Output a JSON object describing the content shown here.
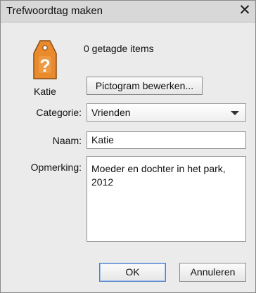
{
  "dialog": {
    "title": "Trefwoordtag maken",
    "close_glyph": "✕",
    "icon": "tag-question-icon",
    "accent_color": "#e98a2c",
    "icon_caption": "Katie",
    "tagged_count_text": "0 getagde items",
    "edit_icon_button": "Pictogram bewerken...",
    "fields": {
      "category_label": "Categorie:",
      "category_value": "Vrienden",
      "name_label": "Naam:",
      "name_value": "Katie",
      "note_label": "Opmerking:",
      "note_value": "Moeder en dochter in het park, 2012"
    },
    "buttons": {
      "ok": "OK",
      "cancel": "Annuleren"
    }
  }
}
